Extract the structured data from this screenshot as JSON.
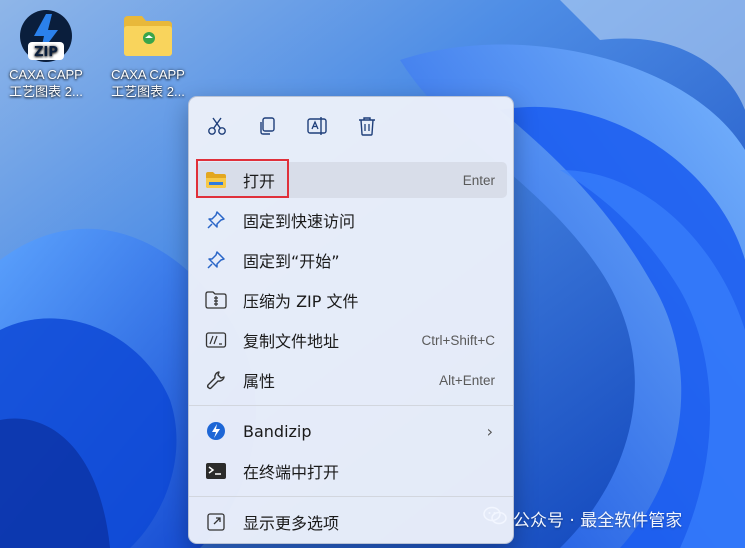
{
  "desktop": {
    "icons": [
      {
        "name_line1": "CAXA CAPP",
        "name_line2": "工艺图表 2...",
        "badge": "ZIP",
        "icon": "zip-archive-icon"
      },
      {
        "name_line1": "CAXA CAPP",
        "name_line2": "工艺图表 2...",
        "icon": "folder-icon"
      }
    ]
  },
  "menu": {
    "toolbar": [
      {
        "icon": "cut-icon"
      },
      {
        "icon": "copy-icon"
      },
      {
        "icon": "rename-icon"
      },
      {
        "icon": "delete-icon"
      }
    ],
    "items": [
      {
        "label": "打开",
        "accel": "Enter",
        "icon": "folder-open-icon"
      },
      {
        "label": "固定到快速访问",
        "accel": "",
        "icon": "pin-icon"
      },
      {
        "label": "固定到“开始”",
        "accel": "",
        "icon": "pin-start-icon"
      },
      {
        "label": "压缩为 ZIP 文件",
        "accel": "",
        "icon": "zip-compress-icon"
      },
      {
        "label": "复制文件地址",
        "accel": "Ctrl+Shift+C",
        "icon": "copy-path-icon"
      },
      {
        "label": "属性",
        "accel": "Alt+Enter",
        "icon": "wrench-icon"
      },
      {
        "label": "Bandizip",
        "accel": "",
        "icon": "bandizip-icon",
        "submenu": true
      },
      {
        "label": "在终端中打开",
        "accel": "",
        "icon": "terminal-icon"
      },
      {
        "label": "显示更多选项",
        "accel": "",
        "icon": "more-options-icon"
      }
    ]
  },
  "watermark": {
    "text": "公众号 · 最全软件管家"
  },
  "colors": {
    "accent": "#1a6fe6",
    "highlight": "#e0303a",
    "menu_bg": "#ecf0fa"
  }
}
